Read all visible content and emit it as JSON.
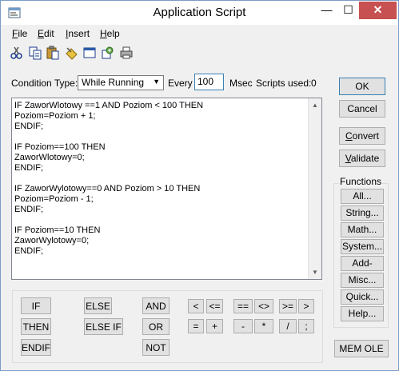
{
  "window": {
    "title": "Application Script",
    "app_icon": "script-window-icon",
    "minimize_glyph": "—",
    "maximize_glyph": "☐",
    "close_glyph": "✕"
  },
  "menu": {
    "file": {
      "label": "File",
      "accel": "F",
      "rest": "ile"
    },
    "edit": {
      "label": "Edit",
      "accel": "E",
      "rest": "dit"
    },
    "insert": {
      "label": "Insert",
      "accel": "I",
      "rest": "nsert"
    },
    "help": {
      "label": "Help",
      "accel": "H",
      "rest": "elp"
    }
  },
  "toolbar": {
    "icons": [
      "cut-icon",
      "copy-icon",
      "paste-icon",
      "find-icon",
      "window-icon",
      "replace-icon",
      "print-icon"
    ]
  },
  "condition": {
    "type_label": "Condition Type:",
    "type_value": "While Running",
    "every_label": "Every",
    "every_value": "100",
    "msec_label": "Msec",
    "scripts_used_label": "Scripts used:",
    "scripts_used_value": "0"
  },
  "script": {
    "text": "IF ZaworWlotowy ==1 AND Poziom < 100 THEN\nPoziom=Poziom + 1;\nENDIF;\n\nIF Poziom==100 THEN\nZaworWlotowy=0;\nENDIF;\n\nIF ZaworWylotowy==0 AND Poziom > 10 THEN\nPoziom=Poziom - 1;\nENDIF;\n\nIF Poziom==10 THEN\nZaworWylotowy=0;\nENDIF;"
  },
  "actions": {
    "ok": "OK",
    "cancel": "Cancel",
    "convert": {
      "accel": "C",
      "rest": "onvert"
    },
    "validate": {
      "accel": "V",
      "rest": "alidate"
    }
  },
  "functions": {
    "label": "Functions",
    "all": "All...",
    "string": "String...",
    "math": "Math...",
    "system": "System...",
    "addons": "Add-ons...",
    "misc": "Misc...",
    "quick": "Quick...",
    "help": "Help..."
  },
  "mem_ole": "MEM OLE",
  "keywords": {
    "if": "IF",
    "then": "THEN",
    "endif": "ENDIF",
    "else": "ELSE",
    "else_if": "ELSE IF",
    "and": "AND",
    "or": "OR",
    "not": "NOT"
  },
  "operators": {
    "lt": "<",
    "le": "<=",
    "eq": "==",
    "ne": "<>",
    "ge": ">=",
    "gt": ">",
    "assign": "=",
    "plus": "+",
    "minus": "-",
    "times": "*",
    "divide": "/",
    "semicolon": ";"
  }
}
